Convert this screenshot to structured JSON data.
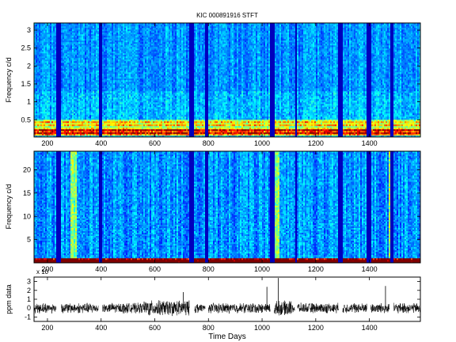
{
  "figure": {
    "title": "KIC 000891916 STFT"
  },
  "chart_data": [
    {
      "type": "heatmap",
      "name": "STFT low-frequency panel",
      "title": "KIC 000891916 STFT",
      "xlabel": "",
      "ylabel": "Frequency c/d",
      "xlim": [
        150,
        1590
      ],
      "ylim": [
        0.02,
        3.2
      ],
      "xticks": [
        200,
        400,
        600,
        800,
        1000,
        1200,
        1400
      ],
      "yticks": [
        0.5,
        1,
        1.5,
        2,
        2.5,
        3
      ],
      "colormap": "jet",
      "power_bands_cd": [
        {
          "center": 0.12,
          "level": "high"
        },
        {
          "center": 0.22,
          "level": "high"
        },
        {
          "center": 0.35,
          "level": "medium"
        },
        {
          "center": 0.45,
          "level": "medium"
        }
      ],
      "data_gaps_days": [
        [
          232,
          252
        ],
        [
          390,
          405
        ],
        [
          730,
          748
        ],
        [
          788,
          800
        ],
        [
          1030,
          1045
        ],
        [
          1122,
          1132
        ],
        [
          1285,
          1300
        ],
        [
          1392,
          1405
        ],
        [
          1475,
          1490
        ]
      ]
    },
    {
      "type": "heatmap",
      "name": "STFT full-frequency panel",
      "xlabel": "",
      "ylabel": "Frequency c/d",
      "xlim": [
        150,
        1590
      ],
      "ylim": [
        0,
        24
      ],
      "xticks": [
        200,
        400,
        600,
        800,
        1000,
        1200,
        1400
      ],
      "yticks": [
        5,
        10,
        15,
        20
      ],
      "colormap": "jet",
      "bright_columns_days": [
        [
          1045,
          1065
        ],
        [
          1470,
          1478
        ],
        [
          285,
          310
        ]
      ],
      "data_gaps_days": [
        [
          232,
          252
        ],
        [
          390,
          405
        ],
        [
          730,
          748
        ],
        [
          788,
          800
        ],
        [
          1030,
          1045
        ],
        [
          1122,
          1132
        ],
        [
          1285,
          1300
        ],
        [
          1392,
          1405
        ],
        [
          1475,
          1490
        ]
      ]
    },
    {
      "type": "line",
      "name": "light curve panel",
      "xlabel": "Time Days",
      "ylabel": "ppm data",
      "y_exponent_label": "x 10",
      "xlim": [
        150,
        1590
      ],
      "ylim": [
        -1.5,
        3.5
      ],
      "xticks": [
        200,
        400,
        600,
        800,
        1000,
        1200,
        1400
      ],
      "yticks": [
        -1,
        0,
        1,
        2,
        3
      ],
      "spikes": [
        {
          "x": 1060,
          "y": 3.4
        },
        {
          "x": 1018,
          "y": 2.4
        },
        {
          "x": 1460,
          "y": 2.5
        },
        {
          "x": 706,
          "y": 1.8
        }
      ],
      "color": "#000000"
    }
  ]
}
